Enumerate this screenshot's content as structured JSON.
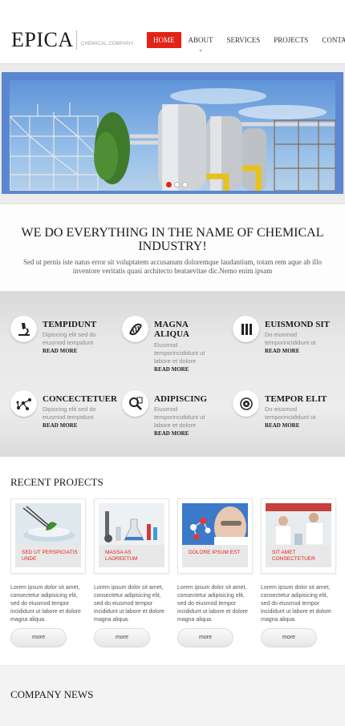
{
  "header": {
    "logo": "EPICA",
    "tagline": "CHEMICAL COMPANY",
    "nav": [
      {
        "label": "HOME",
        "active": true
      },
      {
        "label": "ABOUT",
        "has_dropdown": true
      },
      {
        "label": "SERVICES"
      },
      {
        "label": "PROJECTS"
      },
      {
        "label": "CONTACTS"
      }
    ]
  },
  "slider": {
    "slide_count": 3,
    "active_slide": 1
  },
  "intro": {
    "heading": "WE DO EVERYTHING IN THE NAME OF CHEMICAL INDUSTRY!",
    "text": "Sed ut pernis iste natus error sit voluptatem accusanum doloremque laudantium, totam rem aque ab illo inventore veritatis quasi architecto beataevitae dic.Nemo enim ipsam"
  },
  "features": [
    {
      "icon": "microscope-icon",
      "title": "TEMPIDUNT",
      "text": "Dipiscing elit sed do eiusmod tempidunt",
      "more": "READ MORE"
    },
    {
      "icon": "dna-icon",
      "title": "MAGNA ALIQUA",
      "text": "Eiusmod temporincididunt ut labore et dolore",
      "more": "READ MORE"
    },
    {
      "icon": "test-tubes-icon",
      "title": "EUISMOND SIT",
      "text": "Do eiusmod temporincididunt ut",
      "more": "READ MORE"
    },
    {
      "icon": "molecule-icon",
      "title": "CONCECTETUER",
      "text": "Dipiscing elit sed do eiusmod tempidunt",
      "more": "READ MORE"
    },
    {
      "icon": "magnifier-icon",
      "title": "ADIPISCING",
      "text": "Eiusmod temporincididunt ut labore et dolore",
      "more": "READ MORE"
    },
    {
      "icon": "atom-icon",
      "title": "TEMPOR ELIT",
      "text": "Do eiusmod temporincididunt ut",
      "more": "READ MORE"
    }
  ],
  "projects": {
    "title": "RECENT PROJECTS",
    "items": [
      {
        "caption": "SED UT PERSPICIATIS UNDE",
        "text": "Lorem ipsum dolor sit amet, consectetur adipisicing elit, sed do eiusmod tempor incididunt ut labore et dolore magna aliqua.",
        "more": "more"
      },
      {
        "caption": "MASSA AS LAOREETUM",
        "text": "Lorem ipsum dolor sit amet, consectetur adipisicing elit, sed do eiusmod tempor incididunt ut labore et dolore magna aliqua.",
        "more": "more"
      },
      {
        "caption": "DOLORE IPSUM EST",
        "text": "Lorem ipsum dolor sit amet, consectetur adipisicing elit, sed do eiusmod tempor incididunt ut labore et dolore magna aliqua.",
        "more": "more"
      },
      {
        "caption": "SIT AMET CONSECTETUER",
        "text": "Lorem ipsum dolor sit amet, consectetur adipisicing elit, sed do eiusmod tempor incididunt ut labore et dolore magna aliqua.",
        "more": "more"
      }
    ]
  },
  "news": {
    "title": "COMPANY NEWS"
  },
  "colors": {
    "accent": "#e32316",
    "slider_frame": "#5b87d2"
  }
}
